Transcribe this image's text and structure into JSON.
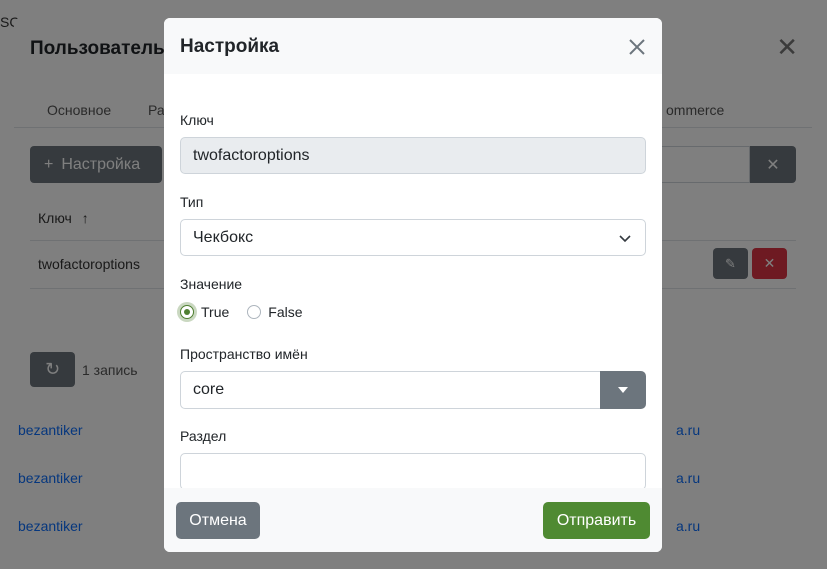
{
  "background": {
    "title_fragment": "Пользователь:",
    "tabs": [
      "Основное",
      "Ра",
      "ommerce"
    ],
    "add_button_label": "Настройка",
    "table_header_key": "Ключ",
    "row_key": "twofactoroptions",
    "record_count": "1 запись",
    "bg_rows": [
      {
        "left": "bezantiker",
        "right": "a.ru"
      },
      {
        "left": "bezantiker",
        "right": "a.ru"
      },
      {
        "left": "bezantiker",
        "right": "a.ru"
      }
    ],
    "top_fragment": "SC"
  },
  "modal": {
    "title": "Настройка",
    "fields": {
      "key_label": "Ключ",
      "key_value": "twofactoroptions",
      "type_label": "Тип",
      "type_value": "Чекбокс",
      "value_label": "Значение",
      "value_options": [
        "True",
        "False"
      ],
      "value_selected": "True",
      "namespace_label": "Пространство имён",
      "namespace_value": "core",
      "section_label": "Раздел",
      "section_value": ""
    },
    "buttons": {
      "cancel_label": "Отмена",
      "submit_label": "Отправить"
    }
  },
  "colors": {
    "primary_green": "#4f8a32",
    "secondary_gray": "#6c757d",
    "danger_red": "#dc3545"
  }
}
